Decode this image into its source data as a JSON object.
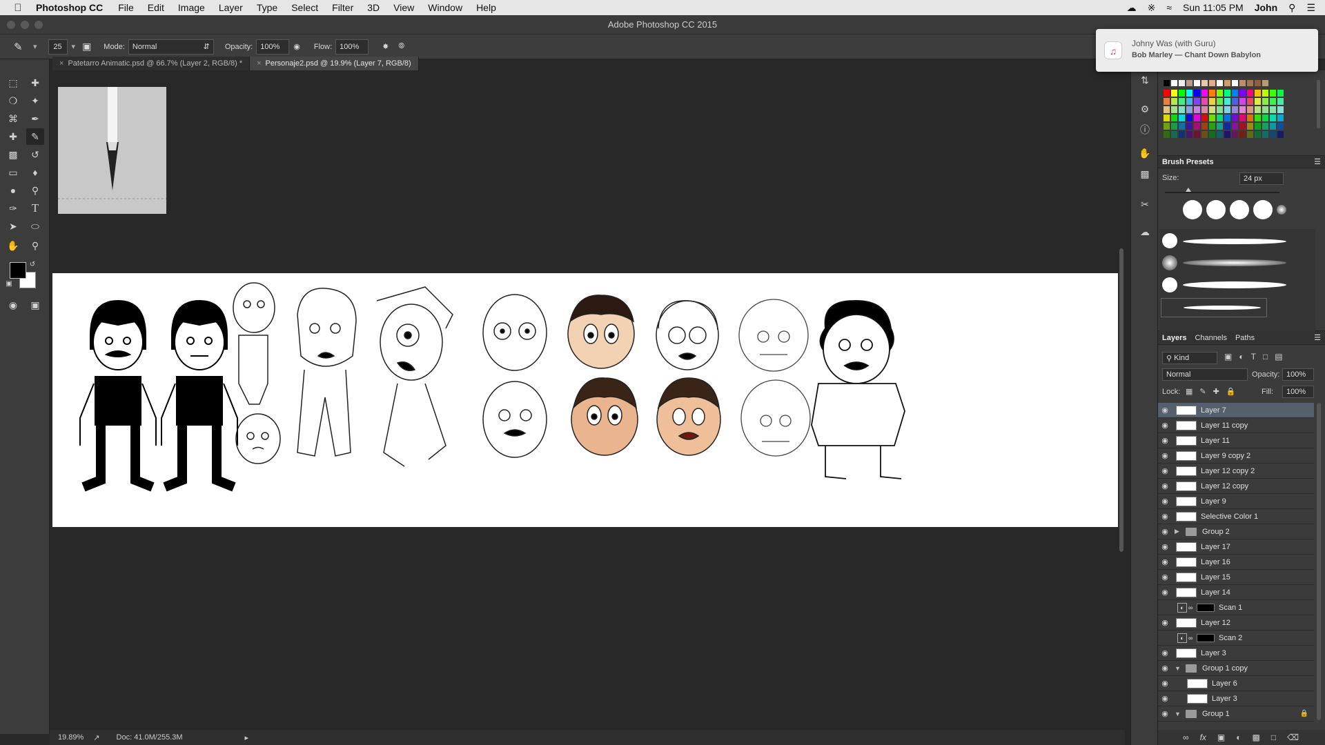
{
  "menubar": {
    "app": "Photoshop CC",
    "items": [
      "File",
      "Edit",
      "Image",
      "Layer",
      "Type",
      "Select",
      "Filter",
      "3D",
      "View",
      "Window",
      "Help"
    ],
    "clock": "Sun 11:05 PM",
    "user": "John"
  },
  "window": {
    "title": "Adobe Photoshop CC 2015"
  },
  "options": {
    "brush_size": "25",
    "mode_label": "Mode:",
    "mode_value": "Normal",
    "opacity_label": "Opacity:",
    "opacity_value": "100%",
    "flow_label": "Flow:",
    "flow_value": "100%"
  },
  "tabs": [
    {
      "label": "Patetarro Animatic.psd @ 66.7% (Layer 2, RGB/8) *"
    },
    {
      "label": "Personaje2.psd @ 19.9% (Layer 7, RGB/8)"
    }
  ],
  "notification": {
    "title": "Johny Was (with Guru)",
    "subtitle": "Bob Marley — Chant Down Babylon"
  },
  "status": {
    "zoom": "19.89%",
    "doc": "Doc: 41.0M/255.3M"
  },
  "brush_presets": {
    "title": "Brush Presets",
    "size_label": "Size:",
    "size_value": "24 px"
  },
  "layers_panel": {
    "tabs": [
      "Layers",
      "Channels",
      "Paths"
    ],
    "kind": "Kind",
    "blend": "Normal",
    "opacity_label": "Opacity:",
    "opacity_value": "100%",
    "lock_label": "Lock:",
    "fill_label": "Fill:",
    "fill_value": "100%",
    "layers": [
      {
        "name": "Layer 7"
      },
      {
        "name": "Layer 11 copy"
      },
      {
        "name": "Layer 11"
      },
      {
        "name": "Layer 9 copy 2"
      },
      {
        "name": "Layer 12 copy 2"
      },
      {
        "name": "Layer 12 copy"
      },
      {
        "name": "Layer 9"
      },
      {
        "name": "Selective Color 1"
      },
      {
        "name": "Group 2"
      },
      {
        "name": "Layer 17"
      },
      {
        "name": "Layer 16"
      },
      {
        "name": "Layer 15"
      },
      {
        "name": "Layer 14"
      },
      {
        "name": "Scan 1"
      },
      {
        "name": "Layer 12"
      },
      {
        "name": "Scan 2"
      },
      {
        "name": "Layer 3"
      },
      {
        "name": "Group 1 copy"
      },
      {
        "name": "Layer 6"
      },
      {
        "name": "Layer 3"
      },
      {
        "name": "Group 1"
      }
    ]
  },
  "colors": {
    "accent": "#56606d",
    "panel": "#3b3b3b",
    "canvas": "#282828"
  }
}
